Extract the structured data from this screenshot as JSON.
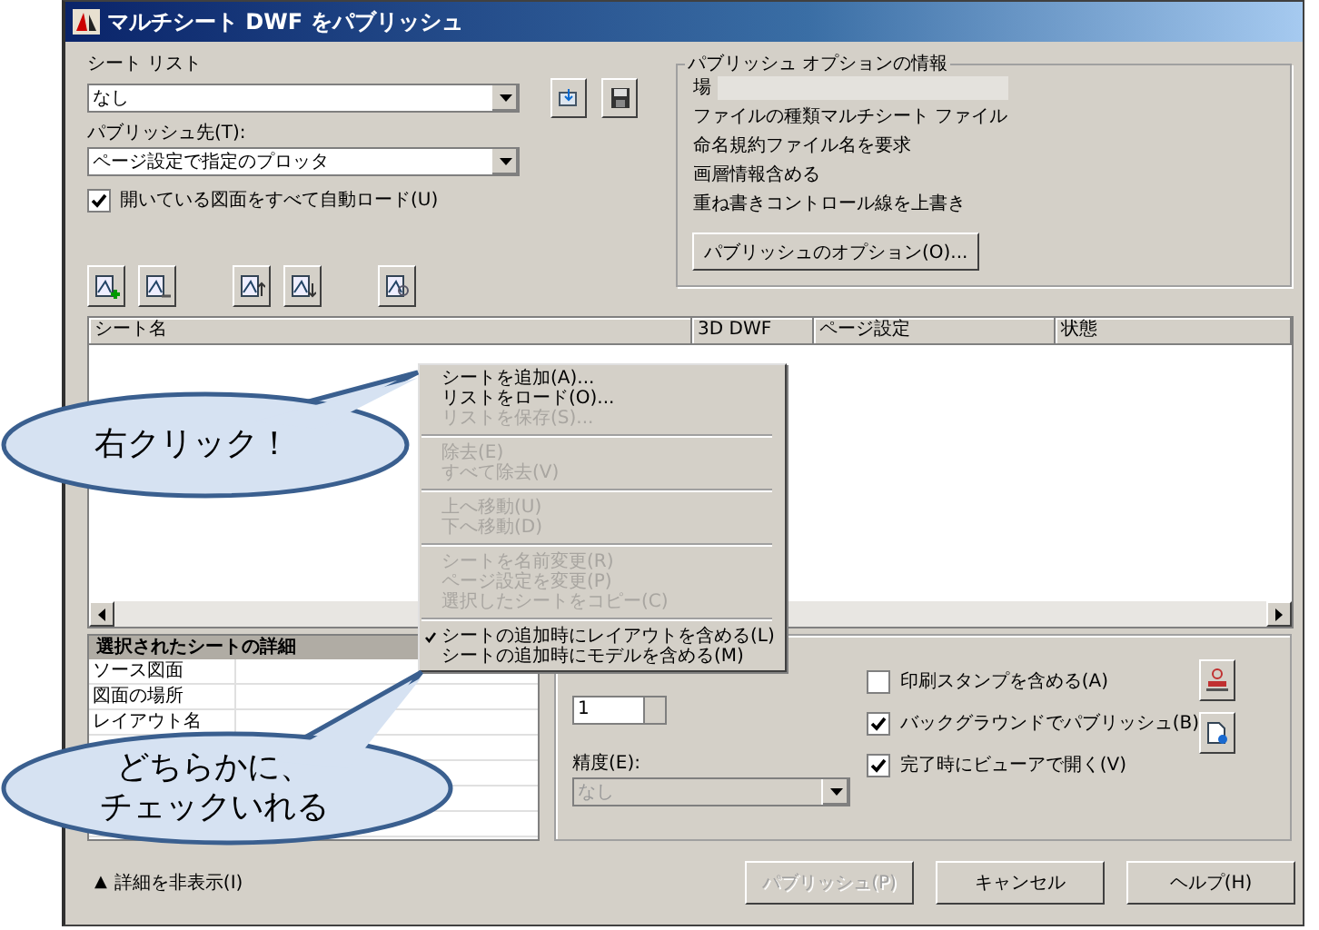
{
  "window": {
    "title": "マルチシート DWF をパブリッシュ"
  },
  "sheet_list": {
    "label": "シート リスト",
    "value": "なし"
  },
  "publish_to": {
    "label": "パブリッシュ先(T):",
    "value": "ページ設定で指定のプロッタ"
  },
  "auto_load": {
    "label": "開いている図面をすべて自動ロード(U)",
    "checked": true
  },
  "publish_options": {
    "title": "パブリッシュ オプションの情報",
    "rows": [
      {
        "kind": "field",
        "label": "場"
      },
      {
        "kind": "text",
        "label": "ファイルの種類マルチシート ファイル"
      },
      {
        "kind": "text",
        "label": "命名規約ファイル名を要求"
      },
      {
        "kind": "text",
        "label": "画層情報含める"
      },
      {
        "kind": "text",
        "label": "重ね書きコントロール線を上書き"
      }
    ],
    "button": "パブリッシュのオプション(O)..."
  },
  "table": {
    "columns": [
      "シート名",
      "3D DWF",
      "ページ設定",
      "状態"
    ]
  },
  "details": {
    "title": "選択されたシートの詳細",
    "rows": [
      "ソース図面",
      "図面の場所",
      "レイアウト名"
    ]
  },
  "settings": {
    "copies": "1",
    "precision_label": "精度(E):",
    "precision_value": "なし",
    "precision_disabled": true,
    "checkboxes": [
      {
        "label": "印刷スタンプを含める(A)",
        "checked": false
      },
      {
        "label": "バックグラウンドでパブリッシュ(B)",
        "checked": true
      },
      {
        "label": "完了時にビューアで開く(V)",
        "checked": true
      }
    ]
  },
  "footer": {
    "toggle_icon": "▲",
    "toggle_label": "詳細を非表示(I)"
  },
  "buttons": [
    {
      "label": "パブリッシュ(P)",
      "disabled": true
    },
    {
      "label": "キャンセル",
      "disabled": false
    },
    {
      "label": "ヘルプ(H)",
      "disabled": false
    }
  ],
  "context_menu": [
    [
      {
        "label": "シートを追加(A)...",
        "disabled": false,
        "checked": false
      },
      {
        "label": "リストをロード(O)...",
        "disabled": false,
        "checked": false
      },
      {
        "label": "リストを保存(S)...",
        "disabled": true,
        "checked": false
      }
    ],
    [
      {
        "label": "除去(E)",
        "disabled": true,
        "checked": false
      },
      {
        "label": "すべて除去(V)",
        "disabled": true,
        "checked": false
      }
    ],
    [
      {
        "label": "上へ移動(U)",
        "disabled": true,
        "checked": false
      },
      {
        "label": "下へ移動(D)",
        "disabled": true,
        "checked": false
      }
    ],
    [
      {
        "label": "シートを名前変更(R)",
        "disabled": true,
        "checked": false
      },
      {
        "label": "ページ設定を変更(P)",
        "disabled": true,
        "checked": false
      },
      {
        "label": "選択したシートをコピー(C)",
        "disabled": true,
        "checked": false
      }
    ],
    [
      {
        "label": "シートの追加時にレイアウトを含める(L)",
        "disabled": false,
        "checked": true
      },
      {
        "label": "シートの追加時にモデルを含める(M)",
        "disabled": false,
        "checked": false
      }
    ]
  ],
  "callouts": [
    {
      "lines": [
        "右クリック！"
      ]
    },
    {
      "lines": [
        "どちらかに、",
        "チェックいれる"
      ]
    }
  ]
}
